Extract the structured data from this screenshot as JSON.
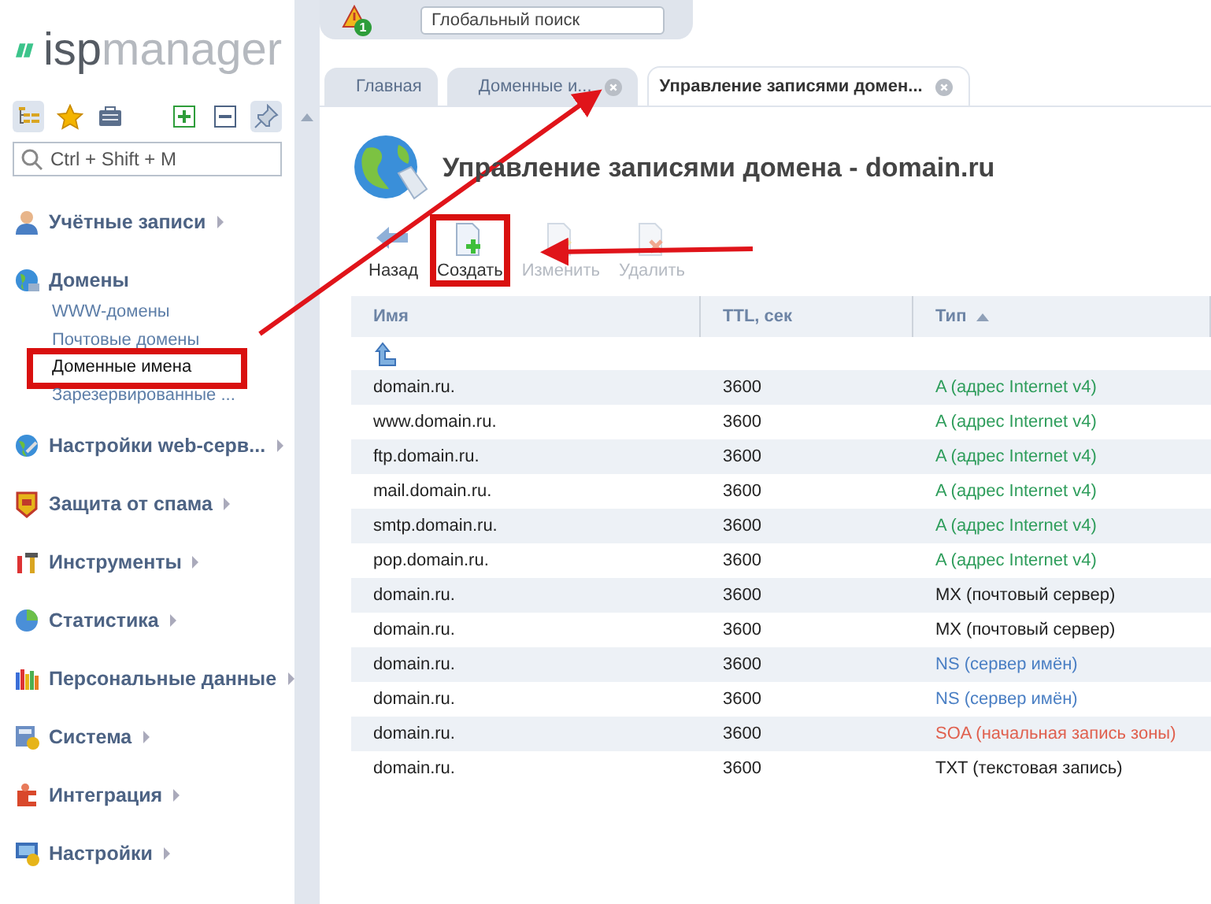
{
  "logo": {
    "accent": "isp",
    "rest": "manager"
  },
  "sidebar": {
    "search": {
      "placeholder": "Ctrl + Shift + M"
    },
    "items": [
      {
        "label": "Учётные записи",
        "expanded": false
      },
      {
        "label": "Домены",
        "expanded": true,
        "children": [
          {
            "label": "WWW-домены",
            "selected": false,
            "highlighted": false
          },
          {
            "label": "Почтовые домены",
            "selected": false,
            "highlighted": false
          },
          {
            "label": "Доменные имена",
            "selected": true,
            "highlighted": true
          },
          {
            "label": "Зарезервированные ...",
            "selected": false,
            "highlighted": false
          }
        ]
      },
      {
        "label": "Настройки web-серв...",
        "expanded": false
      },
      {
        "label": "Защита от спама",
        "expanded": false
      },
      {
        "label": "Инструменты",
        "expanded": false
      },
      {
        "label": "Статистика",
        "expanded": false
      },
      {
        "label": "Персональные данные",
        "expanded": false
      },
      {
        "label": "Система",
        "expanded": false
      },
      {
        "label": "Интеграция",
        "expanded": false
      },
      {
        "label": "Настройки",
        "expanded": false
      }
    ]
  },
  "topbar": {
    "notification_count": "1",
    "global_search": {
      "placeholder": "Глобальный поиск"
    }
  },
  "tabs": [
    {
      "label": "Главная",
      "selected": false,
      "closable": false
    },
    {
      "label": "Доменные и...",
      "selected": false,
      "closable": true
    },
    {
      "label": "Управление записями домен...",
      "selected": true,
      "closable": true
    }
  ],
  "page": {
    "title": "Управление записями домена - domain.ru",
    "toolbar": [
      {
        "label": "Назад",
        "kind": "back",
        "disabled": false,
        "highlighted": false
      },
      {
        "label": "Создать",
        "kind": "create",
        "disabled": false,
        "highlighted": true
      },
      {
        "label": "Изменить",
        "kind": "edit",
        "disabled": true,
        "highlighted": false
      },
      {
        "label": "Удалить",
        "kind": "delete",
        "disabled": true,
        "highlighted": false
      }
    ]
  },
  "table": {
    "columns": [
      {
        "label": "Имя",
        "sorted": false
      },
      {
        "label": "TTL, сек",
        "sorted": false
      },
      {
        "label": "Тип",
        "sorted": true
      }
    ],
    "rows": [
      {
        "name": "domain.ru.",
        "ttl": "3600",
        "type": "A (адрес Internet v4)",
        "color": "#2e9d5b"
      },
      {
        "name": "www.domain.ru.",
        "ttl": "3600",
        "type": "A (адрес Internet v4)",
        "color": "#2e9d5b"
      },
      {
        "name": "ftp.domain.ru.",
        "ttl": "3600",
        "type": "A (адрес Internet v4)",
        "color": "#2e9d5b"
      },
      {
        "name": "mail.domain.ru.",
        "ttl": "3600",
        "type": "A (адрес Internet v4)",
        "color": "#2e9d5b"
      },
      {
        "name": "smtp.domain.ru.",
        "ttl": "3600",
        "type": "A (адрес Internet v4)",
        "color": "#2e9d5b"
      },
      {
        "name": "pop.domain.ru.",
        "ttl": "3600",
        "type": "A (адрес Internet v4)",
        "color": "#2e9d5b"
      },
      {
        "name": "domain.ru.",
        "ttl": "3600",
        "type": "MX (почтовый сервер)",
        "color": "#222222"
      },
      {
        "name": "domain.ru.",
        "ttl": "3600",
        "type": "MX (почтовый сервер)",
        "color": "#222222"
      },
      {
        "name": "domain.ru.",
        "ttl": "3600",
        "type": "NS (сервер имён)",
        "color": "#4a7fc4"
      },
      {
        "name": "domain.ru.",
        "ttl": "3600",
        "type": "NS (сервер имён)",
        "color": "#4a7fc4"
      },
      {
        "name": "domain.ru.",
        "ttl": "3600",
        "type": "SOA (начальная запись зоны)",
        "color": "#e0604e"
      },
      {
        "name": "domain.ru.",
        "ttl": "3600",
        "type": "TXT (текстовая запись)",
        "color": "#222222"
      }
    ]
  }
}
